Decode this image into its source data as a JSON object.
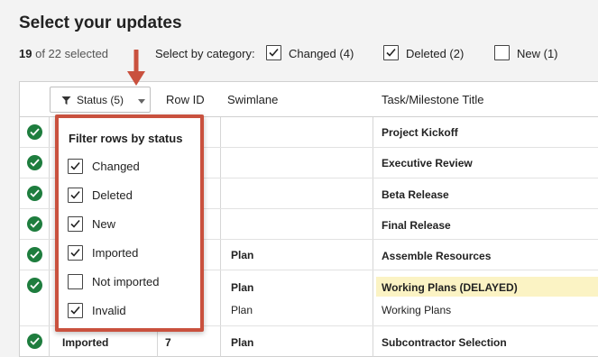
{
  "header": {
    "title": "Select your updates",
    "selected_num": "19",
    "selected_rest": "of 22 selected",
    "category_label": "Select by category:",
    "categories": [
      {
        "label": "Changed (4)",
        "checked": true
      },
      {
        "label": "Deleted (2)",
        "checked": true
      },
      {
        "label": "New (1)",
        "checked": false
      }
    ]
  },
  "grid": {
    "status_button": "Status (5)",
    "columns": [
      "Row ID",
      "Swimlane",
      "Task/Milestone Title"
    ],
    "rows": [
      {
        "ok": true,
        "status": "",
        "row_id": "",
        "swimlane": "",
        "title": "Project Kickoff",
        "title_bold": true
      },
      {
        "ok": true,
        "status": "",
        "row_id": "",
        "swimlane": "",
        "title": "Executive Review",
        "title_bold": true
      },
      {
        "ok": true,
        "status": "",
        "row_id": "",
        "swimlane": "",
        "title": "Beta Release",
        "title_bold": true
      },
      {
        "ok": true,
        "status": "",
        "row_id": "",
        "swimlane": "",
        "title": "Final Release",
        "title_bold": true
      },
      {
        "ok": true,
        "status": "",
        "row_id": "",
        "swimlane": "Plan",
        "title": "Assemble Resources",
        "title_bold": true
      },
      {
        "ok": true,
        "status": "",
        "row_id": "",
        "swimlane": "Plan",
        "title": "Working Plans (DELAYED)",
        "title_bold": true,
        "highlight": true,
        "swimlane2": "Plan",
        "title2": "Working Plans"
      },
      {
        "ok": true,
        "status": "Imported",
        "row_id": "7",
        "swimlane": "Plan",
        "title": "Subcontractor Selection",
        "title_bold": true
      }
    ]
  },
  "filter_popup": {
    "title": "Filter rows by status",
    "options": [
      {
        "label": "Changed",
        "checked": true
      },
      {
        "label": "Deleted",
        "checked": true
      },
      {
        "label": "New",
        "checked": true
      },
      {
        "label": "Imported",
        "checked": true
      },
      {
        "label": "Not imported",
        "checked": false
      },
      {
        "label": "Invalid",
        "checked": true
      }
    ]
  },
  "colors": {
    "accent_red": "#c9513e",
    "ok_green": "#1e7d3e",
    "highlight": "#fbf3c4"
  }
}
